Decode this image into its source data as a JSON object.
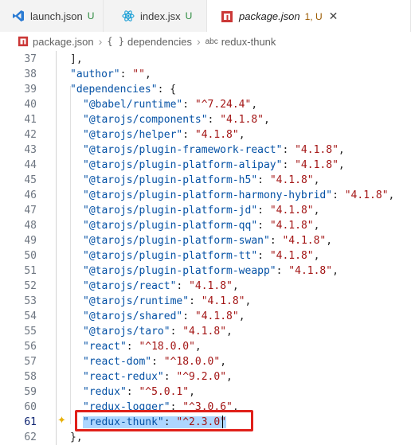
{
  "tabs": [
    {
      "label": "launch.json",
      "status": "U",
      "icon": "vscode-icon"
    },
    {
      "label": "index.jsx",
      "status": "U",
      "icon": "react-icon"
    },
    {
      "label": "package.json",
      "status": "1, U",
      "icon": "npm-icon"
    }
  ],
  "breadcrumb": {
    "file": "package.json",
    "section": "dependencies",
    "item": "redux-thunk"
  },
  "lines": [
    {
      "num": "37",
      "text": "],"
    },
    {
      "num": "38",
      "key": "\"author\"",
      "sep": ": ",
      "val": "\"\"",
      "end": ","
    },
    {
      "num": "39",
      "key": "\"dependencies\"",
      "sep": ": {",
      "val": "",
      "end": ""
    },
    {
      "num": "40",
      "key": "\"@babel/runtime\"",
      "sep": ": ",
      "val": "\"^7.24.4\"",
      "end": ","
    },
    {
      "num": "41",
      "key": "\"@tarojs/components\"",
      "sep": ": ",
      "val": "\"4.1.8\"",
      "end": ","
    },
    {
      "num": "42",
      "key": "\"@tarojs/helper\"",
      "sep": ": ",
      "val": "\"4.1.8\"",
      "end": ","
    },
    {
      "num": "43",
      "key": "\"@tarojs/plugin-framework-react\"",
      "sep": ": ",
      "val": "\"4.1.8\"",
      "end": ","
    },
    {
      "num": "44",
      "key": "\"@tarojs/plugin-platform-alipay\"",
      "sep": ": ",
      "val": "\"4.1.8\"",
      "end": ","
    },
    {
      "num": "45",
      "key": "\"@tarojs/plugin-platform-h5\"",
      "sep": ": ",
      "val": "\"4.1.8\"",
      "end": ","
    },
    {
      "num": "46",
      "key": "\"@tarojs/plugin-platform-harmony-hybrid\"",
      "sep": ": ",
      "val": "\"4.1.8\"",
      "end": ","
    },
    {
      "num": "47",
      "key": "\"@tarojs/plugin-platform-jd\"",
      "sep": ": ",
      "val": "\"4.1.8\"",
      "end": ","
    },
    {
      "num": "48",
      "key": "\"@tarojs/plugin-platform-qq\"",
      "sep": ": ",
      "val": "\"4.1.8\"",
      "end": ","
    },
    {
      "num": "49",
      "key": "\"@tarojs/plugin-platform-swan\"",
      "sep": ": ",
      "val": "\"4.1.8\"",
      "end": ","
    },
    {
      "num": "50",
      "key": "\"@tarojs/plugin-platform-tt\"",
      "sep": ": ",
      "val": "\"4.1.8\"",
      "end": ","
    },
    {
      "num": "51",
      "key": "\"@tarojs/plugin-platform-weapp\"",
      "sep": ": ",
      "val": "\"4.1.8\"",
      "end": ","
    },
    {
      "num": "52",
      "key": "\"@tarojs/react\"",
      "sep": ": ",
      "val": "\"4.1.8\"",
      "end": ","
    },
    {
      "num": "53",
      "key": "\"@tarojs/runtime\"",
      "sep": ": ",
      "val": "\"4.1.8\"",
      "end": ","
    },
    {
      "num": "54",
      "key": "\"@tarojs/shared\"",
      "sep": ": ",
      "val": "\"4.1.8\"",
      "end": ","
    },
    {
      "num": "55",
      "key": "\"@tarojs/taro\"",
      "sep": ": ",
      "val": "\"4.1.8\"",
      "end": ","
    },
    {
      "num": "56",
      "key": "\"react\"",
      "sep": ": ",
      "val": "\"^18.0.0\"",
      "end": ","
    },
    {
      "num": "57",
      "key": "\"react-dom\"",
      "sep": ": ",
      "val": "\"^18.0.0\"",
      "end": ","
    },
    {
      "num": "58",
      "key": "\"react-redux\"",
      "sep": ": ",
      "val": "\"^9.2.0\"",
      "end": ","
    },
    {
      "num": "59",
      "key": "\"redux\"",
      "sep": ": ",
      "val": "\"^5.0.1\"",
      "end": ","
    },
    {
      "num": "60",
      "key": "\"redux-logger\"",
      "sep": ": ",
      "val": "\"^3.0.6\"",
      "end": ","
    },
    {
      "num": "61",
      "key": "\"redux-thunk\"",
      "sep": ": ",
      "val": "\"^2.3.0\"",
      "end": "",
      "selected": true
    },
    {
      "num": "62",
      "text": "},"
    }
  ],
  "colors": {
    "key": "#0451a5",
    "string": "#a31515",
    "selection": "#add6ff",
    "highlight_border": "#e0201a"
  }
}
